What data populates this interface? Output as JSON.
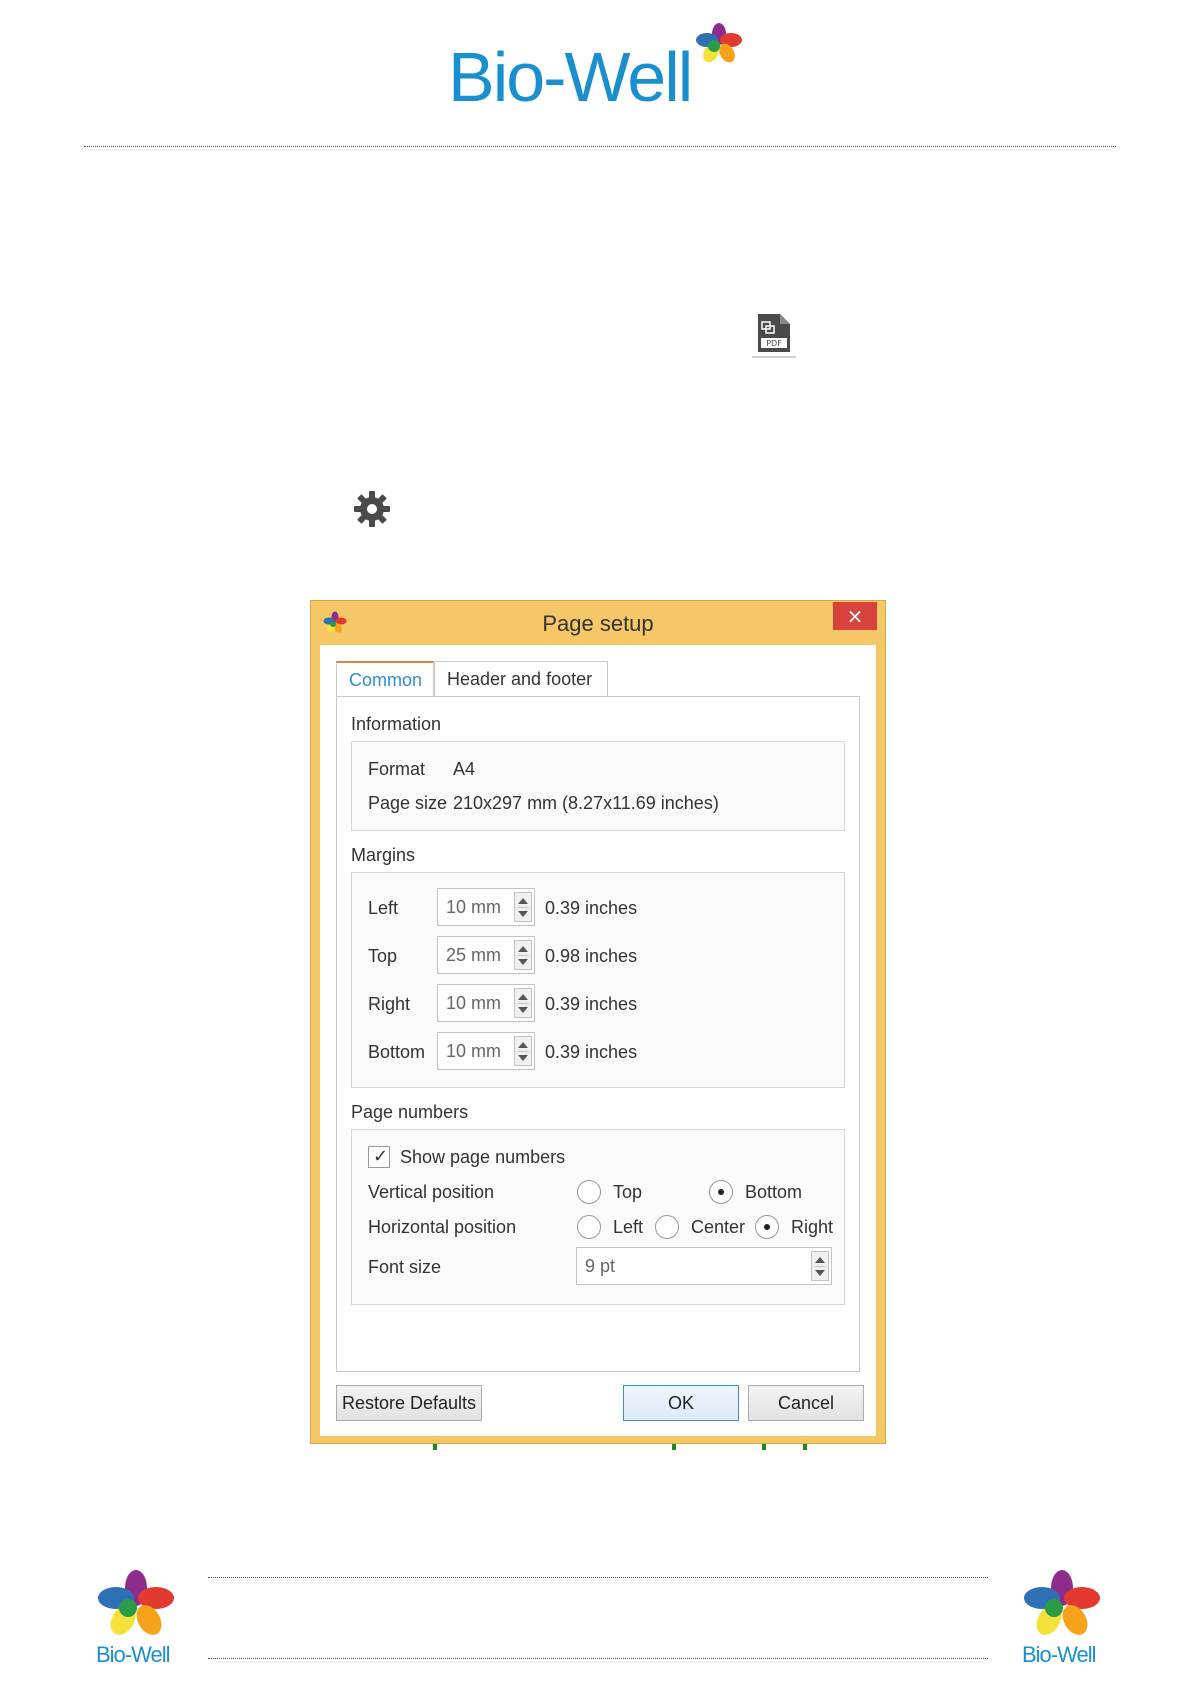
{
  "header": {
    "logo_text": "Bio-Well"
  },
  "dialog": {
    "title": "Page setup",
    "close_glyph": "×",
    "tabs": [
      {
        "label": "Common",
        "active": true
      },
      {
        "label": "Header and footer",
        "active": false
      }
    ],
    "information": {
      "label": "Information",
      "format_label": "Format",
      "format_value": "A4",
      "page_size_label": "Page size",
      "page_size_value": "210x297 mm (8.27x11.69 inches)"
    },
    "margins": {
      "label": "Margins",
      "rows": [
        {
          "label": "Left",
          "value": "10 mm",
          "inches": "0.39 inches"
        },
        {
          "label": "Top",
          "value": "25 mm",
          "inches": "0.98 inches"
        },
        {
          "label": "Right",
          "value": "10 mm",
          "inches": "0.39 inches"
        },
        {
          "label": "Bottom",
          "value": "10 mm",
          "inches": "0.39 inches"
        }
      ]
    },
    "page_numbers": {
      "label": "Page numbers",
      "show_label": "Show page numbers",
      "show_checked": true,
      "vertical_label": "Vertical position",
      "vertical_options": [
        "Top",
        "Bottom"
      ],
      "vertical_selected": "Bottom",
      "horizontal_label": "Horizontal position",
      "horizontal_options": [
        "Left",
        "Center",
        "Right"
      ],
      "horizontal_selected": "Right",
      "font_size_label": "Font size",
      "font_size_value": "9 pt"
    },
    "buttons": {
      "restore": "Restore Defaults",
      "ok": "OK",
      "cancel": "Cancel"
    }
  },
  "footer": {
    "left_logo_text": "Bio-Well",
    "right_logo_text": "Bio-Well"
  },
  "colors": {
    "brand_blue": "#1a8fcf",
    "dialog_frame": "#f5c766",
    "close_red": "#d8443c",
    "tab_active_text": "#2f8fd0"
  }
}
